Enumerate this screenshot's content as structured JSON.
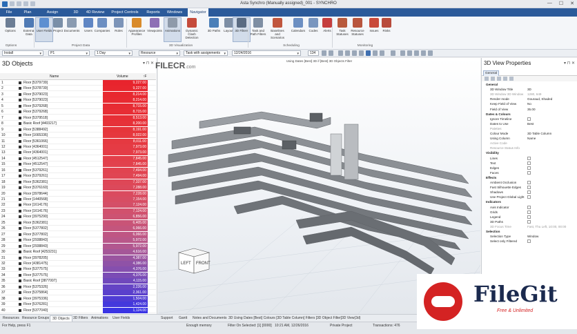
{
  "window": {
    "title": "Asta Synchro (Manually assigned)_001 - SYNCHRO",
    "controls": [
      "—",
      "☐",
      "✕"
    ]
  },
  "menu": {
    "tabs": [
      "File",
      "Plan",
      "Assign Resources",
      "3D",
      "4D Review",
      "Project Controls",
      "Reports",
      "Windows",
      "Navigator"
    ],
    "active": "Navigator"
  },
  "ribbon": {
    "buttons": [
      {
        "label": "Options",
        "color": "#6b7d95"
      },
      {
        "label": "External Data",
        "color": "#4f7ab5"
      },
      {
        "label": "User Fields",
        "color": "#5d8fd1"
      },
      {
        "label": "Project",
        "color": "#7a8fa8"
      },
      {
        "label": "Documents",
        "color": "#8a9bb1"
      },
      {
        "label": "Users",
        "color": "#5f86c4"
      },
      {
        "label": "Companies",
        "color": "#6c8fc2"
      },
      {
        "label": "Roles",
        "color": "#7c94b8"
      },
      {
        "label": "Appearance Profiles",
        "color": "#d98b2b"
      },
      {
        "label": "Viewpoints",
        "color": "#8d6fb5"
      },
      {
        "label": "Animations",
        "color": "#8e9aaa"
      },
      {
        "label": "Dynamic Clash Detection",
        "color": "#c54b3b"
      },
      {
        "label": "3D Paths",
        "color": "#4b7fb8"
      },
      {
        "label": "Layouts",
        "color": "#7d8ea4"
      },
      {
        "label": "3D Filters",
        "color": "#5a6b82"
      },
      {
        "label": "Task and Path Filters",
        "color": "#7e8ea3"
      },
      {
        "label": "Baselines and Scenarios",
        "color": "#c0563e"
      },
      {
        "label": "Calendars",
        "color": "#6c8fc2"
      },
      {
        "label": "Codes",
        "color": "#7996bf"
      },
      {
        "label": "Alerts",
        "color": "#c53e3e"
      },
      {
        "label": "Task Statuses",
        "color": "#b85a3d"
      },
      {
        "label": "Resource Statuses",
        "color": "#b8553d"
      },
      {
        "label": "Issues",
        "color": "#c94a3a"
      },
      {
        "label": "Risks",
        "color": "#b84b3b"
      }
    ],
    "groups": [
      "Options",
      "Project Data",
      "3D Visualization",
      "Scheduling",
      "Monitoring"
    ]
  },
  "toolbar": {
    "view_mode": "Install",
    "schedule_filter": "P1",
    "step": "1 Day",
    "resource_mode": "Resource",
    "task_filter": "Task with assignments",
    "date": "12/24/2016",
    "zoom": "134"
  },
  "left_panel": {
    "title": "3D Objects",
    "col_name": "Name",
    "col_volume": "Volume",
    "col_sort": "↑F",
    "rows": [
      {
        "n": "1",
        "name": "Floor [5379739]",
        "vol": "9,227.00",
        "color": "#e8242d"
      },
      {
        "n": "2",
        "name": "Floor [5378739]",
        "vol": "9,227.00",
        "color": "#e8262e"
      },
      {
        "n": "3",
        "name": "Floor [5379023]",
        "vol": "8,214.00",
        "color": "#e8282f"
      },
      {
        "n": "4",
        "name": "Floor [5379023]",
        "vol": "8,214.00",
        "color": "#e82a31"
      },
      {
        "n": "5",
        "name": "Floor [5379268]",
        "vol": "8,715.00",
        "color": "#e72c33"
      },
      {
        "n": "6",
        "name": "Floor [5379268]",
        "vol": "8,715.00",
        "color": "#e72e35"
      },
      {
        "n": "7",
        "name": "Floor [5379518]",
        "vol": "8,513.00",
        "color": "#e73037"
      },
      {
        "n": "8",
        "name": "Basic Roof [4403217]",
        "vol": "8,200.00",
        "color": "#e63239"
      },
      {
        "n": "9",
        "name": "Floor [5388492]",
        "vol": "8,191.00",
        "color": "#e6353b"
      },
      {
        "n": "10",
        "name": "Floor [1665336]",
        "vol": "8,022.00",
        "color": "#e6373e"
      },
      {
        "n": "11",
        "name": "Floor [5361066]",
        "vol": "8,011.00",
        "color": "#e53941"
      },
      {
        "n": "12",
        "name": "Floor [4364001]",
        "vol": "7,973.00",
        "color": "#e53b44"
      },
      {
        "n": "13",
        "name": "Floor [4364001]",
        "vol": "7,973.00",
        "color": "#e43d47"
      },
      {
        "n": "14",
        "name": "Floor [4512547]",
        "vol": "7,845.00",
        "color": "#e33f4a"
      },
      {
        "n": "15",
        "name": "Floor [4512547]",
        "vol": "7,845.00",
        "color": "#e2414d"
      },
      {
        "n": "16",
        "name": "Floor [5379261]",
        "vol": "7,494.00",
        "color": "#e14350"
      },
      {
        "n": "17",
        "name": "Floor [5379261]",
        "vol": "7,494.00",
        "color": "#e04553"
      },
      {
        "n": "18",
        "name": "Floor [5362381]",
        "vol": "7,337.00",
        "color": "#de4757"
      },
      {
        "n": "19",
        "name": "Floor [5376160]",
        "vol": "7,288.00",
        "color": "#dc495b"
      },
      {
        "n": "20",
        "name": "Floor [3978644]",
        "vol": "7,228.00",
        "color": "#da4b5f"
      },
      {
        "n": "21",
        "name": "Floor [1440568]",
        "vol": "7,154.00",
        "color": "#d74d63"
      },
      {
        "n": "22",
        "name": "Floor [1614176]",
        "vol": "7,124.00",
        "color": "#d44f68"
      },
      {
        "n": "23",
        "name": "Floor [1614176]",
        "vol": "7,124.00",
        "color": "#d1516d"
      },
      {
        "n": "24",
        "name": "Floor [3975290]",
        "vol": "6,856.00",
        "color": "#cd5372"
      },
      {
        "n": "25",
        "name": "Floor [5362381]",
        "vol": "6,405.00",
        "color": "#c95477"
      },
      {
        "n": "26",
        "name": "Floor [5377802]",
        "vol": "6,066.00",
        "color": "#c4557d"
      },
      {
        "n": "27",
        "name": "Floor [5377802]",
        "vol": "6,066.00",
        "color": "#bf5683"
      },
      {
        "n": "28",
        "name": "Floor [2938843]",
        "vol": "5,972.00",
        "color": "#b95789"
      },
      {
        "n": "29",
        "name": "Floor [2938843]",
        "vol": "5,972.00",
        "color": "#b2578f"
      },
      {
        "n": "30",
        "name": "Basic Roof [4253231]",
        "vol": "4,616.00",
        "color": "#a55798"
      },
      {
        "n": "31",
        "name": "Floor [3978205]",
        "vol": "4,387.00",
        "color": "#9a55a0"
      },
      {
        "n": "32",
        "name": "Floor [4381475]",
        "vol": "4,386.00",
        "color": "#8f52a7"
      },
      {
        "n": "33",
        "name": "Floor [5377575]",
        "vol": "4,376.00",
        "color": "#854fae"
      },
      {
        "n": "34",
        "name": "Floor [5377575]",
        "vol": "4,376.00",
        "color": "#7b4cb5"
      },
      {
        "n": "35",
        "name": "Basic Roof [3877007]",
        "vol": "4,115.00",
        "color": "#7048bc"
      },
      {
        "n": "36",
        "name": "Floor [5375326]",
        "vol": "2,226.00",
        "color": "#6544c4"
      },
      {
        "n": "37",
        "name": "Floor [5375864]",
        "vol": "2,361.00",
        "color": "#5a40cc"
      },
      {
        "n": "38",
        "name": "Floor [3975336]",
        "vol": "1,504.00",
        "color": "#4f3cd4"
      },
      {
        "n": "39",
        "name": "Floor [5376281]",
        "vol": "1,424.00",
        "color": "#4438dc"
      },
      {
        "n": "40",
        "name": "Floor [5377040]",
        "vol": "1,124.00",
        "color": "#3a34e4"
      }
    ]
  },
  "viewport": {
    "title": "Using Dates [Best] 3D if [Best] 3D Objects Filter",
    "cube_left": "LEFT",
    "cube_front": "FRONT"
  },
  "right_panel": {
    "title": "3D View Properties",
    "tab": "General",
    "props": [
      {
        "type": "cat",
        "name": "General"
      },
      {
        "type": "val",
        "name": "3D Window Title",
        "value": "3D"
      },
      {
        "type": "dim",
        "name": "3D Window 3D Window",
        "value": "1280, 649"
      },
      {
        "type": "val",
        "name": "Render mode",
        "value": "Gouraud, Shaded"
      },
      {
        "type": "val",
        "name": "Keep Field of View",
        "value": "No"
      },
      {
        "type": "val",
        "name": "Field of View",
        "value": "35.00"
      },
      {
        "type": "cat",
        "name": "Dates & Colours"
      },
      {
        "type": "cb",
        "name": "Ignore Timeline"
      },
      {
        "type": "val",
        "name": "Dates to Use",
        "value": "Best"
      },
      {
        "type": "dim",
        "name": "Palettes",
        "value": ""
      },
      {
        "type": "val",
        "name": "Colour Mode",
        "value": "3D Table Column"
      },
      {
        "type": "val",
        "name": "Using Column",
        "value": "Name"
      },
      {
        "type": "dim",
        "name": "Active Code",
        "value": ""
      },
      {
        "type": "dim",
        "name": "Resource Status Info",
        "value": ""
      },
      {
        "type": "cat",
        "name": "Visibility"
      },
      {
        "type": "cb",
        "name": "Lines"
      },
      {
        "type": "cb",
        "name": "Text"
      },
      {
        "type": "cb",
        "name": "Edges"
      },
      {
        "type": "cb",
        "name": "Faces"
      },
      {
        "type": "cat",
        "name": "Effects"
      },
      {
        "type": "cb",
        "name": "Ambient Occlusion"
      },
      {
        "type": "cb",
        "name": "Fast Silhouette Edges"
      },
      {
        "type": "cb",
        "name": "Shadows"
      },
      {
        "type": "cb",
        "name": "Use Project Global Light"
      },
      {
        "type": "cat",
        "name": "Indicators"
      },
      {
        "type": "cb",
        "name": "Axis Indicator"
      },
      {
        "type": "cb",
        "name": "Grids"
      },
      {
        "type": "cb",
        "name": "Legend"
      },
      {
        "type": "cb",
        "name": "3D Paths"
      },
      {
        "type": "dim",
        "name": "3D Focus Time",
        "value": "Fast, Thu Left, 10:00, 00:00"
      },
      {
        "type": "cat",
        "name": "Selection"
      },
      {
        "type": "val",
        "name": "Selection Type",
        "value": "Window"
      },
      {
        "type": "cb",
        "name": "Select only Filtered"
      }
    ]
  },
  "bottom_tabs": [
    "Resources",
    "Resource Groups",
    "3D Objects",
    "3D Filters",
    "Animations",
    "User Fields",
    "Support",
    "Gantt",
    "Notes and Documents",
    "3D Using Dates [Best] Colours [3D Table Column] Filters [3D Object Filter]",
    "3D View(3d)"
  ],
  "active_bottom_tab": "3D Objects",
  "status": {
    "help": "For Help, press F1",
    "memory": "Enough memory",
    "filter": "Filter On   Selected: [1] [0000]",
    "time": "10:21 AM, 12/26/2016",
    "access": "Private Project",
    "transactions": "Transactions: 476"
  },
  "watermarks": {
    "filecr": "FILECR",
    "filecr_sub": ".com",
    "filegit": "FileGit",
    "filegit_tag": "Free & Unlimited"
  }
}
